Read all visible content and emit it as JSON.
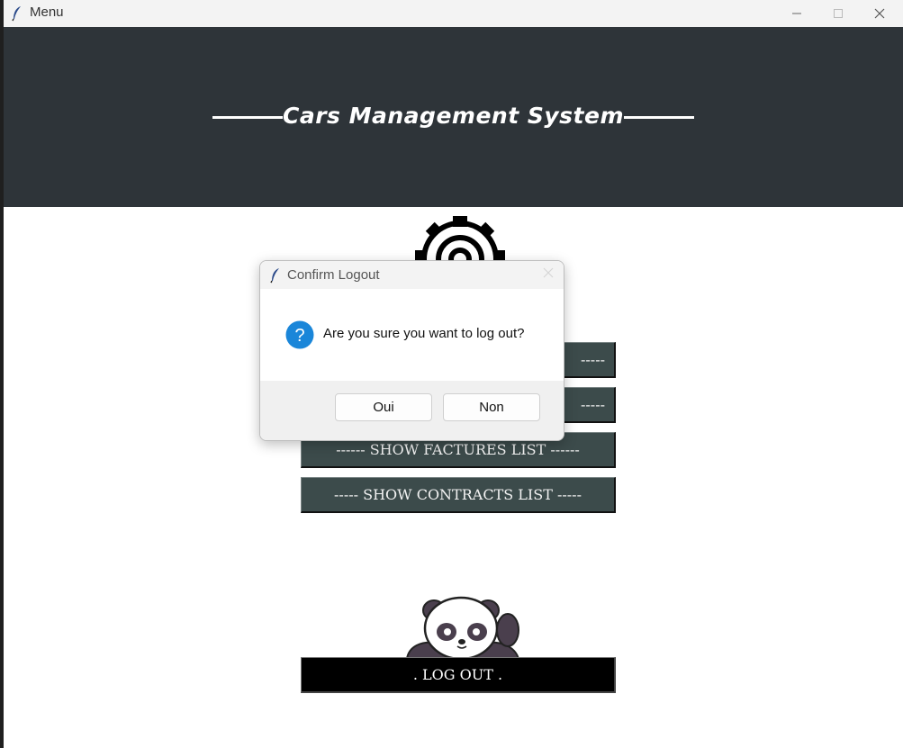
{
  "window": {
    "title": "Menu",
    "controls": [
      "minimize-icon",
      "maximize-icon",
      "close-icon"
    ]
  },
  "header": {
    "title": "Cars Management System",
    "background": "#2e3439"
  },
  "menu": {
    "buttons": [
      {
        "label": "------ SHOW FACTURES LIST ------"
      },
      {
        "label": "----- SHOW CONTRACTS LIST -----"
      }
    ],
    "hidden_button_tails": [
      "-----",
      "-----"
    ],
    "button_color": "#3c4b4b"
  },
  "logout": {
    "label": ". LOG OUT ."
  },
  "dialog": {
    "title": "Confirm Logout",
    "message": "Are you sure you want to log out?",
    "yes_label": "Oui",
    "no_label": "Non",
    "icon": "question-icon",
    "icon_color": "#1a86d9"
  }
}
